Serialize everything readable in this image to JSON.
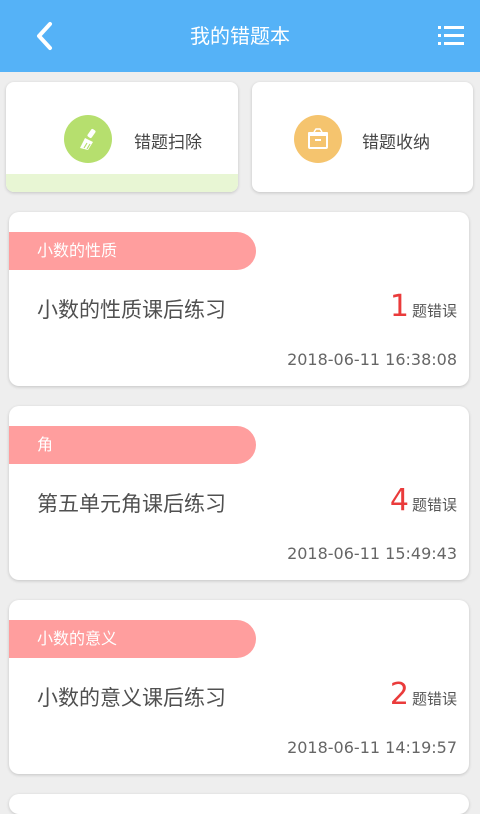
{
  "header": {
    "title": "我的错题本",
    "back_icon": "chevron-left-icon",
    "menu_icon": "list-icon",
    "color": "#55b2f7"
  },
  "actions": [
    {
      "label": "错题扫除",
      "icon": "broom-icon",
      "icon_color": "#b6df6e",
      "active": true
    },
    {
      "label": "错题收纳",
      "icon": "storage-box-icon",
      "icon_color": "#f5c46e",
      "active": false
    }
  ],
  "records": [
    {
      "tag": "小数的性质",
      "title": "小数的性质课后练习",
      "count": "1",
      "suffix": "题错误",
      "time": "2018-06-11 16:38:08"
    },
    {
      "tag": "角",
      "title": "第五单元角课后练习",
      "count": "4",
      "suffix": "题错误",
      "time": "2018-06-11 15:49:43"
    },
    {
      "tag": "小数的意义",
      "title": "小数的意义课后练习",
      "count": "2",
      "suffix": "题错误",
      "time": "2018-06-11 14:19:57"
    }
  ],
  "colors": {
    "tag_bg": "#ff9e9e",
    "count": "#ea3b3b",
    "active_bar": "#e8f6d4"
  }
}
